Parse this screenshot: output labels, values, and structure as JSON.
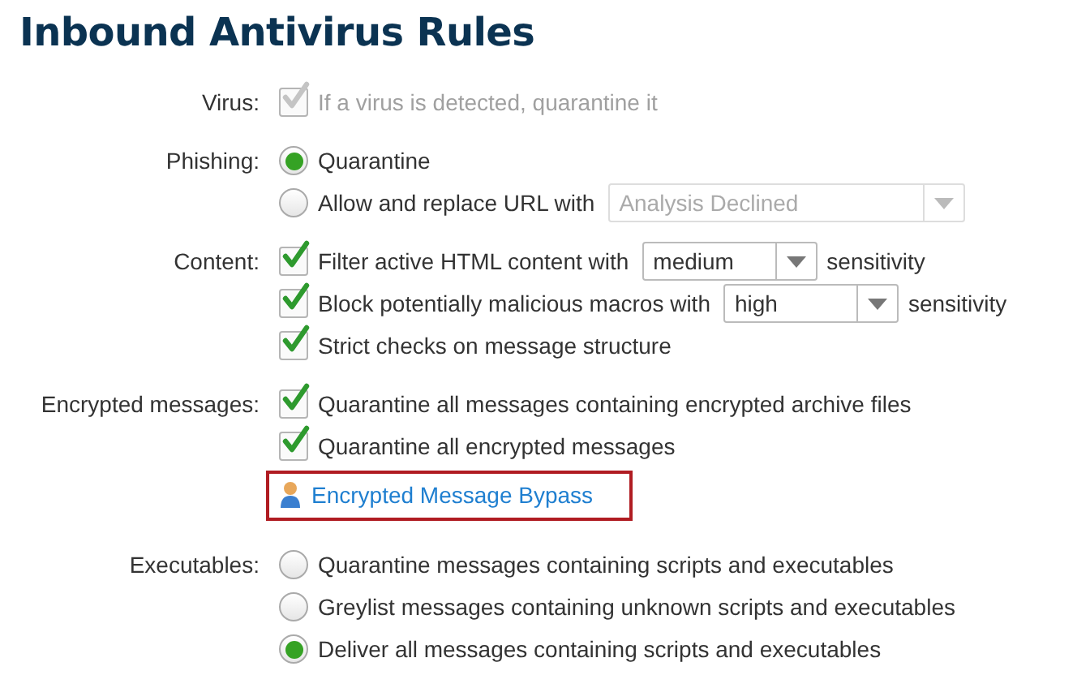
{
  "title": "Inbound Antivirus Rules",
  "sections": [
    {
      "label": "Virus:",
      "items": [
        {
          "kind": "checkbox",
          "text": "If a virus is detected, quarantine it",
          "checked": true,
          "disabled": true
        }
      ]
    },
    {
      "label": "Phishing:",
      "items": [
        {
          "kind": "radio",
          "text": "Quarantine",
          "selected": true,
          "disabled": false
        },
        {
          "kind": "radio",
          "text": "Allow and replace URL with",
          "selected": false,
          "disabled": false,
          "select": {
            "value": "Analysis Declined",
            "disabled": true
          }
        }
      ]
    },
    {
      "label": "Content:",
      "items": [
        {
          "kind": "checkbox",
          "text": "Filter active HTML content with",
          "checked": true,
          "disabled": false,
          "select": {
            "value": "medium",
            "disabled": false
          },
          "suffix": "sensitivity"
        },
        {
          "kind": "checkbox",
          "text": "Block potentially malicious macros with",
          "checked": true,
          "disabled": false,
          "select": {
            "value": "high",
            "disabled": false
          },
          "suffix": "sensitivity"
        },
        {
          "kind": "checkbox",
          "text": "Strict checks on message structure",
          "checked": true,
          "disabled": false
        }
      ]
    },
    {
      "label": "Encrypted messages:",
      "items": [
        {
          "kind": "checkbox",
          "text": "Quarantine all messages containing encrypted archive files",
          "checked": true,
          "disabled": false
        },
        {
          "kind": "checkbox",
          "text": "Quarantine all encrypted messages",
          "checked": true,
          "disabled": false
        },
        {
          "kind": "link",
          "text": "Encrypted Message Bypass",
          "highlighted": true
        }
      ]
    },
    {
      "label": "Executables:",
      "items": [
        {
          "kind": "radio",
          "text": "Quarantine messages containing scripts and executables",
          "selected": false,
          "disabled": false
        },
        {
          "kind": "radio",
          "text": "Greylist messages containing unknown scripts and executables",
          "selected": false,
          "disabled": false
        },
        {
          "kind": "radio",
          "text": "Deliver all messages containing scripts and executables",
          "selected": true,
          "disabled": false
        }
      ]
    }
  ]
}
